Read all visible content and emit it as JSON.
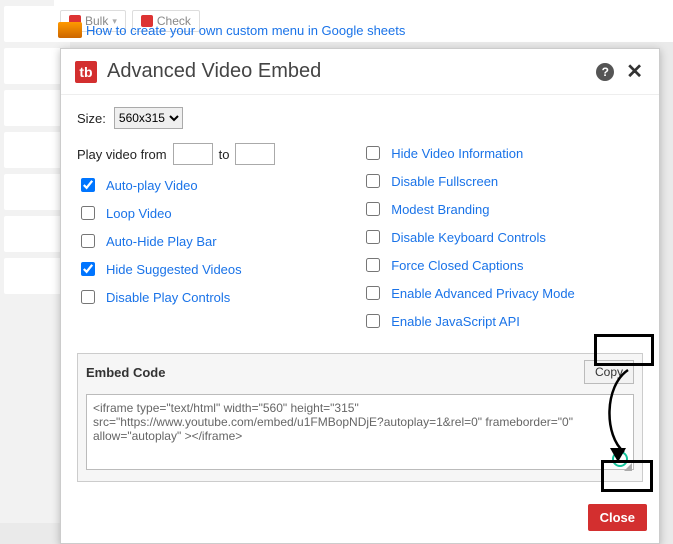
{
  "top": {
    "bulk_label": "Bulk",
    "check_label": "Check",
    "link_text": "How to create your own custom menu in Google sheets"
  },
  "dialog": {
    "title": "Advanced Video Embed",
    "size_label": "Size:",
    "size_value": "560x315",
    "playfrom_label": "Play video from",
    "playfrom_to": "to",
    "options_left": [
      {
        "label": "Auto-play Video",
        "checked": true
      },
      {
        "label": "Loop Video",
        "checked": false
      },
      {
        "label": "Auto-Hide Play Bar",
        "checked": false
      },
      {
        "label": "Hide Suggested Videos",
        "checked": true
      },
      {
        "label": "Disable Play Controls",
        "checked": false
      }
    ],
    "options_right": [
      {
        "label": "Hide Video Information",
        "checked": false
      },
      {
        "label": "Disable Fullscreen",
        "checked": false
      },
      {
        "label": "Modest Branding",
        "checked": false
      },
      {
        "label": "Disable Keyboard Controls",
        "checked": false
      },
      {
        "label": "Force Closed Captions",
        "checked": false
      },
      {
        "label": "Enable Advanced Privacy Mode",
        "checked": false
      },
      {
        "label": "Enable JavaScript API",
        "checked": false
      }
    ],
    "embed_label": "Embed Code",
    "copy_label": "Copy",
    "embed_code": "<iframe type=\"text/html\" width=\"560\" height=\"315\" src=\"https://www.youtube.com/embed/u1FMBopNDjE?autoplay=1&rel=0\" frameborder=\"0\" allow=\"autoplay\" ></iframe>",
    "close_label": "Close"
  }
}
